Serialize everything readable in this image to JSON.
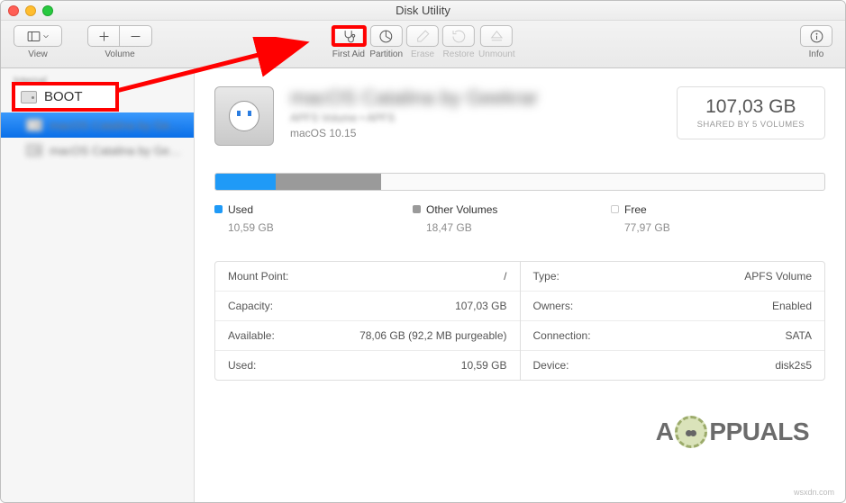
{
  "window": {
    "title": "Disk Utility"
  },
  "toolbar": {
    "view_label": "View",
    "volume_label": "Volume",
    "first_aid_label": "First Aid",
    "partition_label": "Partition",
    "erase_label": "Erase",
    "restore_label": "Restore",
    "unmount_label": "Unmount",
    "info_label": "Info"
  },
  "sidebar": {
    "section": "Internal",
    "items": [
      {
        "label": "BOOT"
      },
      {
        "label": "macOS Catalina by Ge…"
      },
      {
        "label": "macOS Catalina by Ge…"
      }
    ]
  },
  "volume": {
    "name": "macOS Catalina by Geekrar",
    "subtitle": "APFS Volume • APFS",
    "os": "macOS 10.15",
    "size": "107,03 GB",
    "shared": "SHARED BY 5 VOLUMES"
  },
  "usage": {
    "used_pct": 9.9,
    "other_pct": 17.3,
    "legend": {
      "used": {
        "label": "Used",
        "value": "10,59 GB"
      },
      "other": {
        "label": "Other Volumes",
        "value": "18,47 GB"
      },
      "free": {
        "label": "Free",
        "value": "77,97 GB"
      }
    }
  },
  "info": {
    "left": [
      {
        "k": "Mount Point:",
        "v": "/"
      },
      {
        "k": "Capacity:",
        "v": "107,03 GB"
      },
      {
        "k": "Available:",
        "v": "78,06 GB (92,2 MB purgeable)"
      },
      {
        "k": "Used:",
        "v": "10,59 GB"
      }
    ],
    "right": [
      {
        "k": "Type:",
        "v": "APFS Volume"
      },
      {
        "k": "Owners:",
        "v": "Enabled"
      },
      {
        "k": "Connection:",
        "v": "SATA"
      },
      {
        "k": "Device:",
        "v": "disk2s5"
      }
    ]
  },
  "brand": "PPUALS",
  "watermark": "wsxdn.com"
}
